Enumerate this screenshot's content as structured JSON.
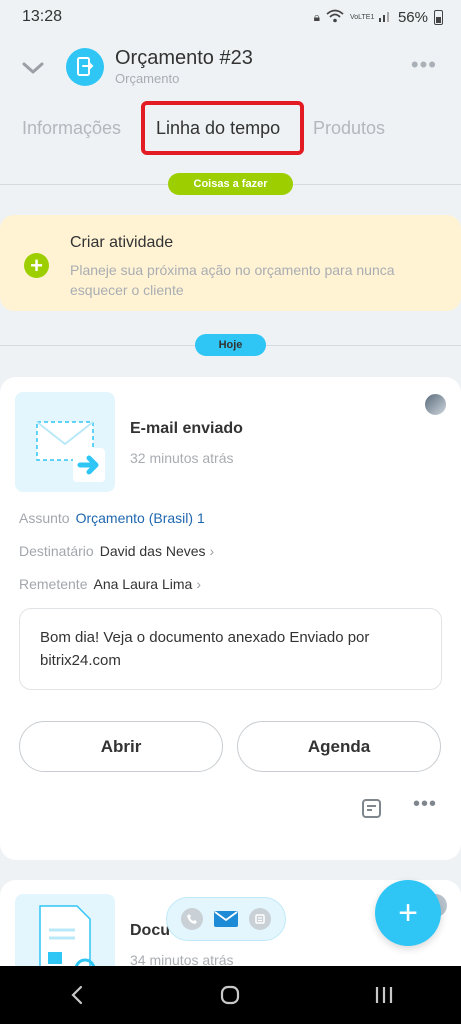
{
  "status_bar": {
    "time": "13:28",
    "volte": "VoLTE1",
    "battery": "56%"
  },
  "header": {
    "title": "Orçamento #23",
    "subtitle": "Orçamento"
  },
  "tabs": [
    {
      "label": "Informações",
      "active": false
    },
    {
      "label": "Linha do tempo",
      "active": true
    },
    {
      "label": "Produtos",
      "active": false
    }
  ],
  "todo_pill": "Coisas a fazer",
  "create_activity": {
    "title": "Criar atividade",
    "description": "Planeje sua próxima ação no orçamento para nunca esquecer o cliente"
  },
  "today_pill": "Hoje",
  "email_card": {
    "title": "E-mail enviado",
    "time": "32 minutos atrás",
    "subject_label": "Assunto",
    "subject_value": "Orçamento (Brasil) 1",
    "recipient_label": "Destinatário",
    "recipient_value": "David das Neves",
    "sender_label": "Remetente",
    "sender_value": "Ana Laura Lima",
    "body": "Bom dia! Veja o documento anexado Enviado por bitrix24.com",
    "open_button": "Abrir",
    "agenda_button": "Agenda"
  },
  "doc_card": {
    "title": "Docu",
    "time": "34 minutos atrás"
  },
  "fab_label": "+",
  "colors": {
    "accent": "#2fc6f6",
    "green": "#9dcf00",
    "highlight": "#e31b23",
    "link": "#2067b0"
  }
}
